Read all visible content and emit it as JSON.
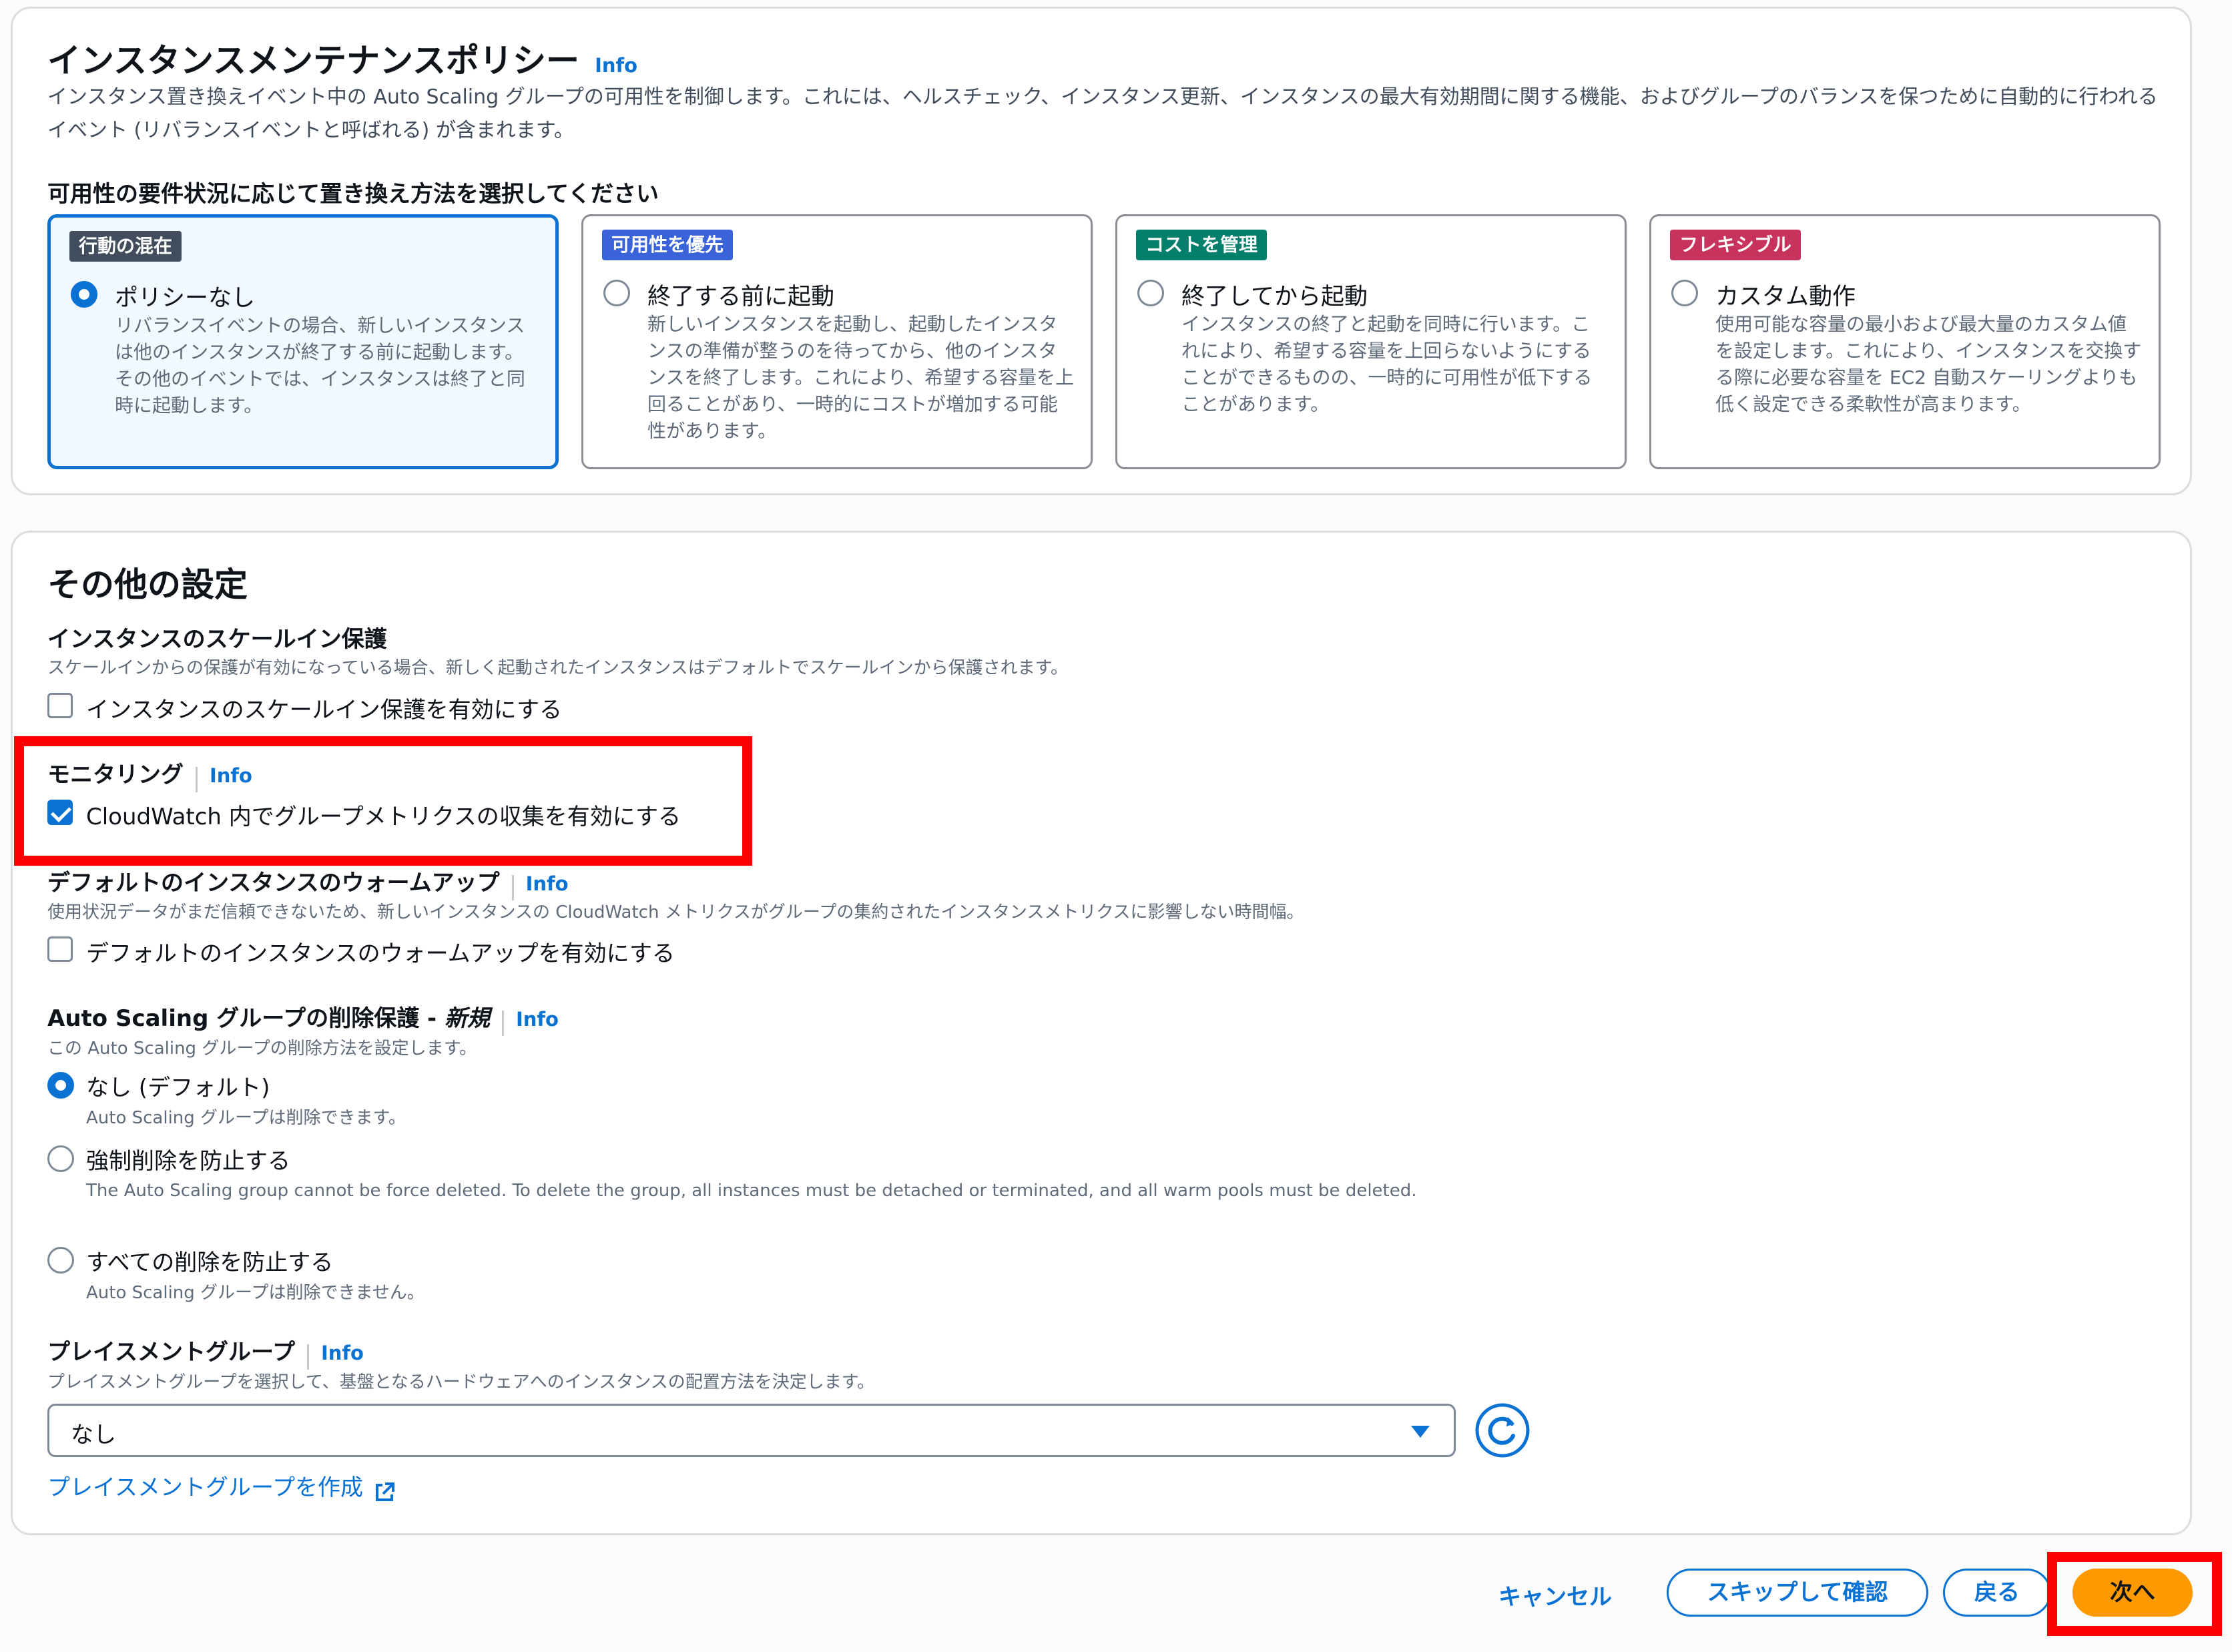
{
  "policy": {
    "title": "インスタンスメンテナンスポリシー",
    "info": "Info",
    "description": "インスタンス置き換えイベント中の Auto Scaling グループの可用性を制御します。これには、ヘルスチェック、インスタンス更新、インスタンスの最大有効期間に関する機能、およびグループのバランスを保つために自動的に行われるイベント (リバランスイベントと呼ばれる) が含まれます。",
    "choose_label": "可用性の要件状況に応じて置き換え方法を選択してください",
    "cards": [
      {
        "badge": "行動の混在",
        "badge_color": "#414d5c",
        "title": "ポリシーなし",
        "selected": true,
        "description": "リバランスイベントの場合、新しいインスタンスは他のインスタンスが終了する前に起動します。その他のイベントでは、インスタンスは終了と同時に起動します。"
      },
      {
        "badge": "可用性を優先",
        "badge_color": "#3b63d9",
        "title": "終了する前に起動",
        "selected": false,
        "description": "新しいインスタンスを起動し、起動したインスタンスの準備が整うのを待ってから、他のインスタンスを終了します。これにより、希望する容量を上回ることがあり、一時的にコストが増加する可能性があります。"
      },
      {
        "badge": "コストを管理",
        "badge_color": "#037f6c",
        "title": "終了してから起動",
        "selected": false,
        "description": "インスタンスの終了と起動を同時に行います。これにより、希望する容量を上回らないようにすることができるものの、一時的に可用性が低下することがあります。"
      },
      {
        "badge": "フレキシブル",
        "badge_color": "#c7335d",
        "title": "カスタム動作",
        "selected": false,
        "description": "使用可能な容量の最小および最大量のカスタム値を設定します。これにより、インスタンスを交換する際に必要な容量を EC2 自動スケーリングよりも低く設定できる柔軟性が高まります。"
      }
    ]
  },
  "other": {
    "title": "その他の設定",
    "scale_in": {
      "title": "インスタンスのスケールイン保護",
      "description": "スケールインからの保護が有効になっている場合、新しく起動されたインスタンスはデフォルトでスケールインから保護されます。",
      "checkbox_label": "インスタンスのスケールイン保護を有効にする",
      "checked": false
    },
    "monitoring": {
      "title": "モニタリング",
      "info": "Info",
      "checkbox_label": "CloudWatch 内でグループメトリクスの収集を有効にする",
      "checked": true
    },
    "warmup": {
      "title": "デフォルトのインスタンスのウォームアップ",
      "info": "Info",
      "description": "使用状況データがまだ信頼できないため、新しいインスタンスの CloudWatch メトリクスがグループの集約されたインスタンスメトリクスに影響しない時間幅。",
      "checkbox_label": "デフォルトのインスタンスのウォームアップを有効にする",
      "checked": false
    },
    "deletion": {
      "title": "Auto Scaling グループの削除保護 - ",
      "title_em": "新規",
      "info": "Info",
      "description": "この Auto Scaling グループの削除方法を設定します。",
      "options": [
        {
          "label": "なし (デフォルト)",
          "description": "Auto Scaling グループは削除できます。",
          "selected": true
        },
        {
          "label": "強制削除を防止する",
          "description": "The Auto Scaling group cannot be force deleted. To delete the group, all instances must be detached or terminated, and all warm pools must be deleted.",
          "selected": false
        },
        {
          "label": "すべての削除を防止する",
          "description": "Auto Scaling グループは削除できません。",
          "selected": false
        }
      ]
    },
    "placement": {
      "title": "プレイスメントグループ",
      "info": "Info",
      "description": "プレイスメントグループを選択して、基盤となるハードウェアへのインスタンスの配置方法を決定します。",
      "selected": "なし",
      "create_link": "プレイスメントグループを作成"
    }
  },
  "footer": {
    "cancel": "キャンセル",
    "skip": "スキップして確認",
    "back": "戻る",
    "next": "次へ"
  },
  "colors": {
    "accent": "#0972d3",
    "primary_button": "#ff9900",
    "highlight": "#ff0000"
  }
}
